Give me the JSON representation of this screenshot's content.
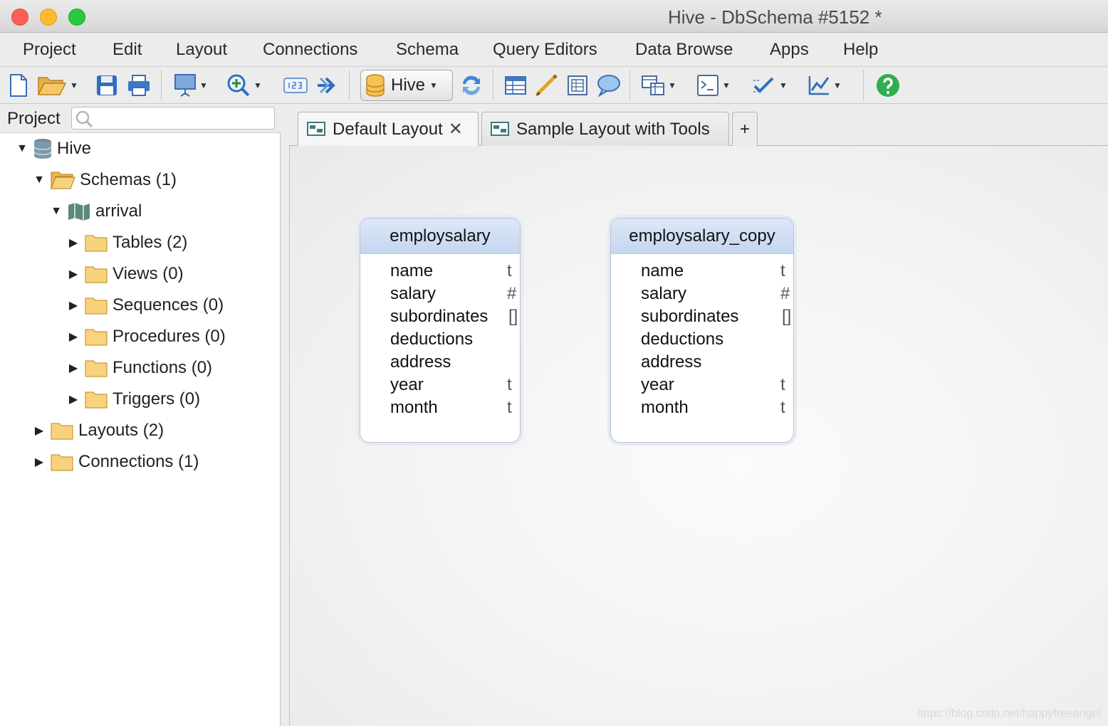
{
  "window": {
    "title": "Hive - DbSchema #5152 *"
  },
  "menu": [
    "Project",
    "Edit",
    "Layout",
    "Connections",
    "Schema",
    "Query Editors",
    "Data Browse",
    "Apps",
    "Help"
  ],
  "toolbar": {
    "connection_label": "Hive"
  },
  "left_panel": {
    "title": "Project",
    "search_placeholder": "",
    "tree": [
      {
        "label": "Hive",
        "expanded": true,
        "icon": "database-icon"
      },
      {
        "label": "Schemas (1)",
        "expanded": true,
        "icon": "folder-open-icon"
      },
      {
        "label": "arrival",
        "expanded": true,
        "icon": "schema-map-icon"
      },
      {
        "label": "Tables (2)",
        "expanded": false,
        "icon": "folder-icon"
      },
      {
        "label": "Views (0)",
        "expanded": false,
        "icon": "folder-icon"
      },
      {
        "label": "Sequences (0)",
        "expanded": false,
        "icon": "folder-icon"
      },
      {
        "label": "Procedures (0)",
        "expanded": false,
        "icon": "folder-icon"
      },
      {
        "label": "Functions (0)",
        "expanded": false,
        "icon": "folder-icon"
      },
      {
        "label": "Triggers (0)",
        "expanded": false,
        "icon": "folder-icon"
      },
      {
        "label": "Layouts (2)",
        "expanded": false,
        "icon": "folder-icon"
      },
      {
        "label": "Connections (1)",
        "expanded": false,
        "icon": "folder-icon"
      }
    ]
  },
  "tabs": [
    {
      "label": "Default Layout",
      "active": true,
      "close": "✕"
    },
    {
      "label": "Sample Layout with Tools",
      "active": false
    }
  ],
  "tab_add_label": "+",
  "entities": [
    {
      "name": "employsalary",
      "columns": [
        {
          "name": "name",
          "type": "t"
        },
        {
          "name": "salary",
          "type": "#"
        },
        {
          "name": "subordinates",
          "type": "[]"
        },
        {
          "name": "deductions",
          "type": ""
        },
        {
          "name": "address",
          "type": ""
        },
        {
          "name": "year",
          "type": "t"
        },
        {
          "name": "month",
          "type": "t"
        }
      ]
    },
    {
      "name": "employsalary_copy",
      "columns": [
        {
          "name": "name",
          "type": "t"
        },
        {
          "name": "salary",
          "type": "#"
        },
        {
          "name": "subordinates",
          "type": "[]"
        },
        {
          "name": "deductions",
          "type": ""
        },
        {
          "name": "address",
          "type": ""
        },
        {
          "name": "year",
          "type": "t"
        },
        {
          "name": "month",
          "type": "t"
        }
      ]
    }
  ],
  "watermark": "https://blog.csdn.net/happyfreeangel"
}
